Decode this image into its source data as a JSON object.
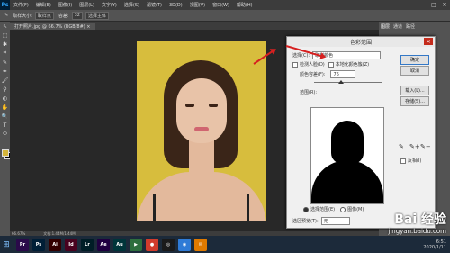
{
  "app": {
    "logo": "Ps",
    "menu": [
      "文件(F)",
      "编辑(E)",
      "图像(I)",
      "图层(L)",
      "文字(Y)",
      "选择(S)",
      "滤镜(T)",
      "3D(D)",
      "视图(V)",
      "窗口(W)",
      "帮助(H)"
    ],
    "window_controls": [
      "—",
      "□",
      "✕"
    ]
  },
  "options": {
    "size_label": "取样大小:",
    "size_value": "取样点",
    "tolerance_label": "容差:",
    "tolerance_value": "32",
    "extra": "选择主体"
  },
  "document_tab": {
    "label": "打开照片.jpg @ 66.7% (RGB/8#) ×"
  },
  "tools": [
    "↖",
    "⬚",
    "✱",
    "⌗",
    "✎",
    "✒",
    "🖌",
    "⚲",
    "◐",
    "✋",
    "🔍",
    "T",
    "⬭"
  ],
  "status": {
    "zoom": "66.67%",
    "doc": "文档:1.44M/1.44M"
  },
  "panels": {
    "tabs": [
      "图层",
      "通道",
      "路径"
    ]
  },
  "dialog": {
    "title": "色彩范围",
    "close": "✕",
    "select_label": "选择(C):",
    "select_value": "取样颜色",
    "localized_label": "检测人脸(D)",
    "localized_clusters": "本地化颜色簇(Z)",
    "fuzziness_label": "颜色容差(F):",
    "fuzziness_value": "76",
    "range_label": "范围(R):",
    "buttons": {
      "ok": "确定",
      "cancel": "取消",
      "load": "载入(L)...",
      "save": "存储(S)..."
    },
    "eyedroppers": [
      "✎",
      "✎+",
      "✎−"
    ],
    "invert_label": "反相(I)",
    "radio_selection": "选择范围(E)",
    "radio_image": "图像(M)",
    "preview_label": "选区预览(T):",
    "preview_value": "无"
  },
  "taskbar": {
    "apps": [
      "Pr",
      "Ps",
      "Ai",
      "Id",
      "Lr",
      "Ae",
      "Au",
      "▶",
      "●",
      "◎",
      "◉",
      "✉"
    ],
    "time": "6:51",
    "date": "2020/1/11"
  },
  "watermark": {
    "logo": "Bai 经验",
    "url": "jingyan.baidu.com"
  }
}
